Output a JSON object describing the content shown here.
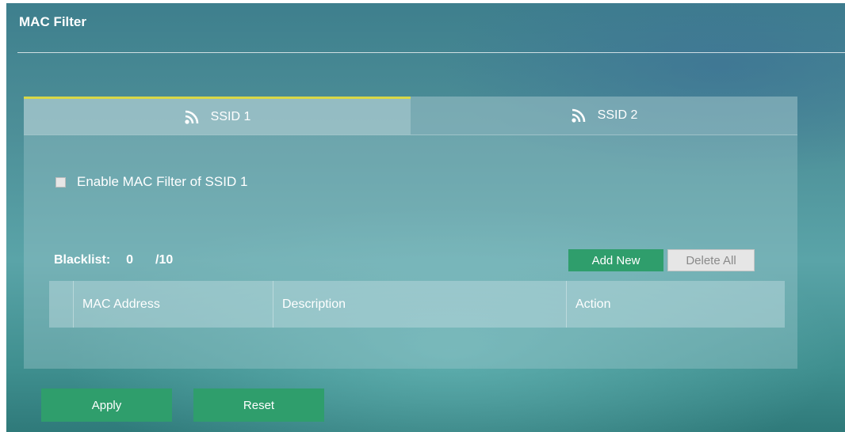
{
  "page": {
    "title": "MAC Filter"
  },
  "tabs": [
    {
      "label": "SSID 1",
      "icon": "wifi-icon",
      "active": true
    },
    {
      "label": "SSID 2",
      "icon": "wifi-icon",
      "active": false
    }
  ],
  "filter": {
    "enable_label": "Enable MAC Filter of SSID 1",
    "enabled": false
  },
  "blacklist": {
    "label": "Blacklist:",
    "count": "0",
    "max": "/10",
    "add_label": "Add New",
    "delete_label": "Delete All"
  },
  "table": {
    "columns": [
      "MAC Address",
      "Description",
      "Action"
    ],
    "rows": []
  },
  "actions": {
    "apply_label": "Apply",
    "reset_label": "Reset"
  },
  "colors": {
    "accent_green": "#2f9e6c",
    "active_tab_border": "#d8d847"
  }
}
